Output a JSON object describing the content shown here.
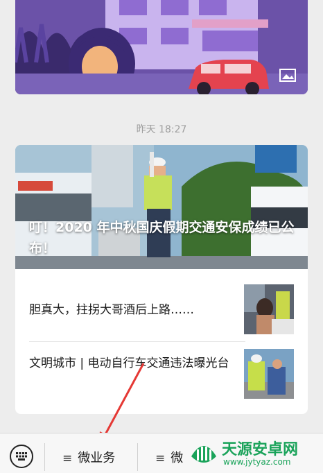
{
  "timestamp": "昨天 18:27",
  "article": {
    "hero_title": "叮！2020 年中秋国庆假期交通安保成绩已公布！",
    "items": [
      {
        "title": "胆真大，拄拐大哥酒后上路……"
      },
      {
        "title": "文明城市 | 电动自行车交通违法曝光台"
      }
    ]
  },
  "menu": {
    "keyboard_icon": "keyboard-icon",
    "item1": "微业务",
    "item2": "微",
    "hamburger": "≡"
  },
  "watermark": {
    "brand": "天源安卓网",
    "url": "www.jytyaz.com"
  },
  "colors": {
    "arrow": "#e53935",
    "background": "#ededed",
    "watermark_green": "#1aa35a"
  }
}
